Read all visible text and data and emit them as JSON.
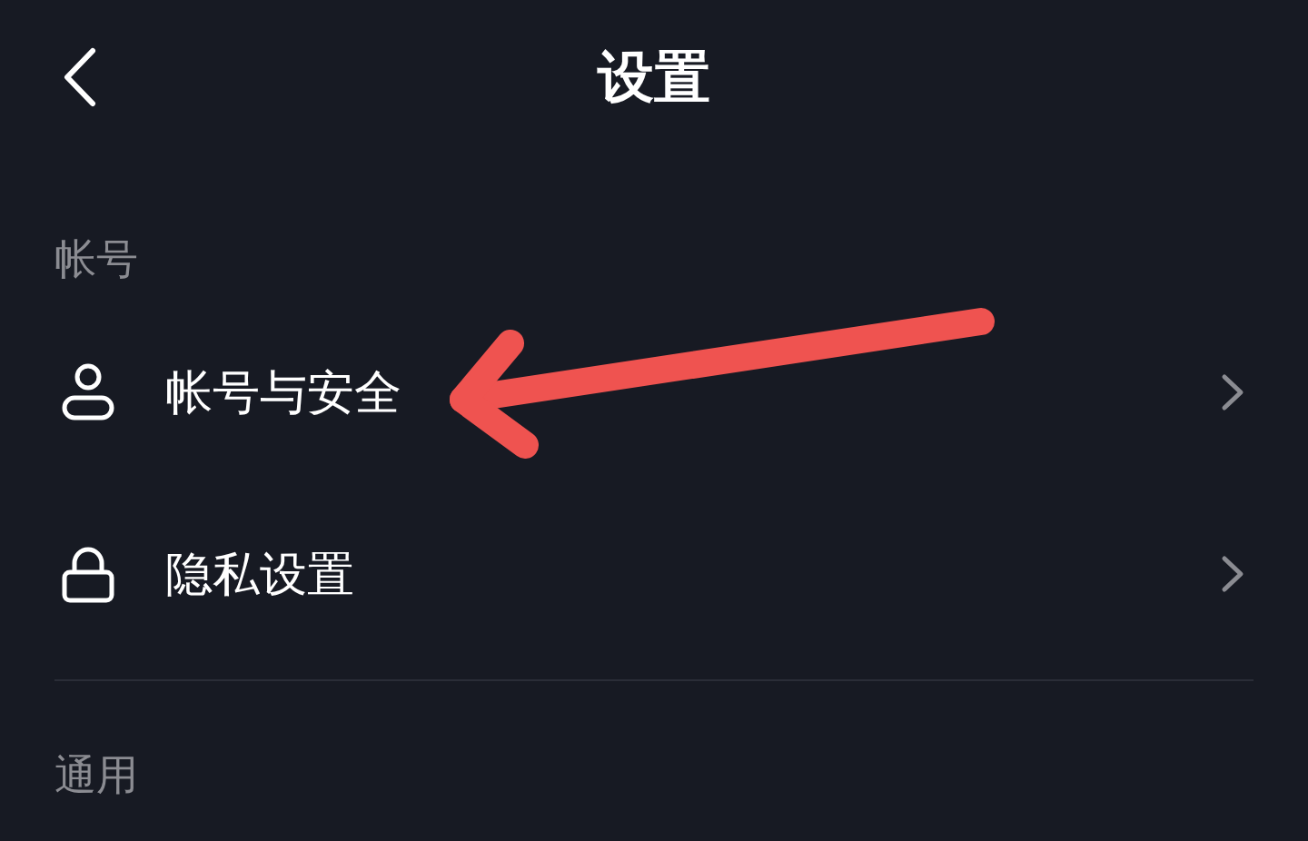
{
  "header": {
    "title": "设置"
  },
  "sections": [
    {
      "label": "帐号",
      "items": [
        {
          "label": "帐号与安全",
          "kind": "person"
        },
        {
          "label": "隐私设置",
          "kind": "lock"
        }
      ]
    },
    {
      "label": "通用"
    }
  ]
}
